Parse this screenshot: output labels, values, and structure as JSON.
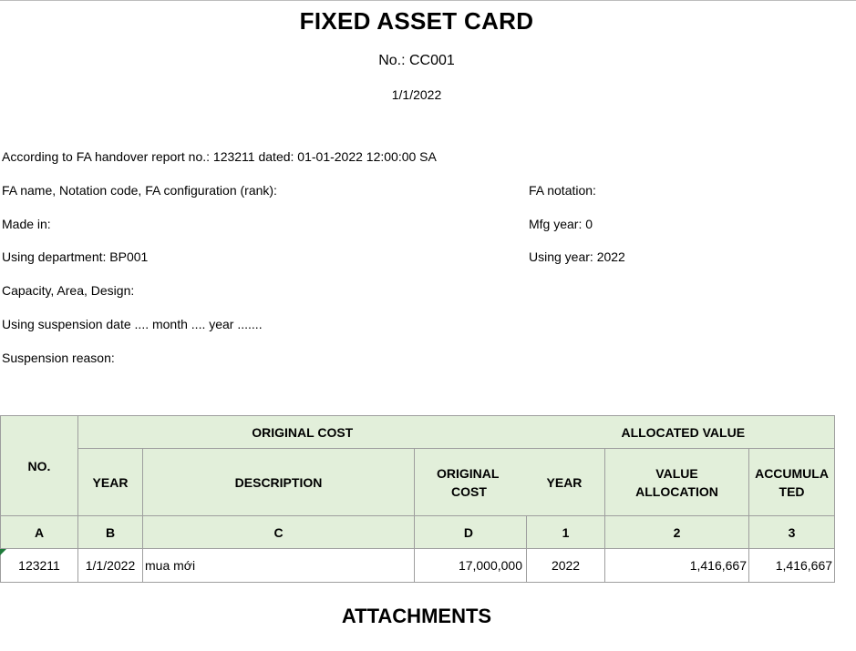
{
  "header": {
    "title": "FIXED ASSET CARD",
    "number": "No.: CC001",
    "date": "1/1/2022"
  },
  "info": {
    "handover": "According to FA handover report no.: 123211  dated: 01-01-2022 12:00:00 SA",
    "fa_name": "FA name, Notation code, FA configuration (rank):",
    "fa_notation": "FA notation:",
    "made_in": "Made in:",
    "mfg_year": "Mfg year: 0",
    "using_department": "Using department:  BP001",
    "using_year": "Using year: 2022",
    "capacity": "Capacity, Area, Design:",
    "suspension_date": "Using suspension date .... month .... year .......",
    "suspension_reason": "Suspension reason:"
  },
  "table": {
    "no_header": "NO.",
    "group_original_cost": "ORIGINAL COST",
    "group_allocated_value": "ALLOCATED VALUE",
    "col_year": "YEAR",
    "col_description": "DESCRIPTION",
    "col_original_cost_1": "ORIGINAL",
    "col_original_cost_2": "COST",
    "col_alloc_year": "YEAR",
    "col_value_allocation_1": "VALUE",
    "col_value_allocation_2": "ALLOCATION",
    "col_accumulated_1": "ACCUMULA",
    "col_accumulated_2": "TED",
    "codes": [
      "A",
      "B",
      "C",
      "D",
      "1",
      "2",
      "3"
    ],
    "rows": [
      {
        "no": "123211",
        "year": "1/1/2022",
        "description": "mua mới",
        "original_cost": "17,000,000",
        "alloc_year": "2022",
        "value_allocation": "1,416,667",
        "accumulated": "1,416,667"
      }
    ]
  },
  "attachments": {
    "title": "ATTACHMENTS"
  }
}
